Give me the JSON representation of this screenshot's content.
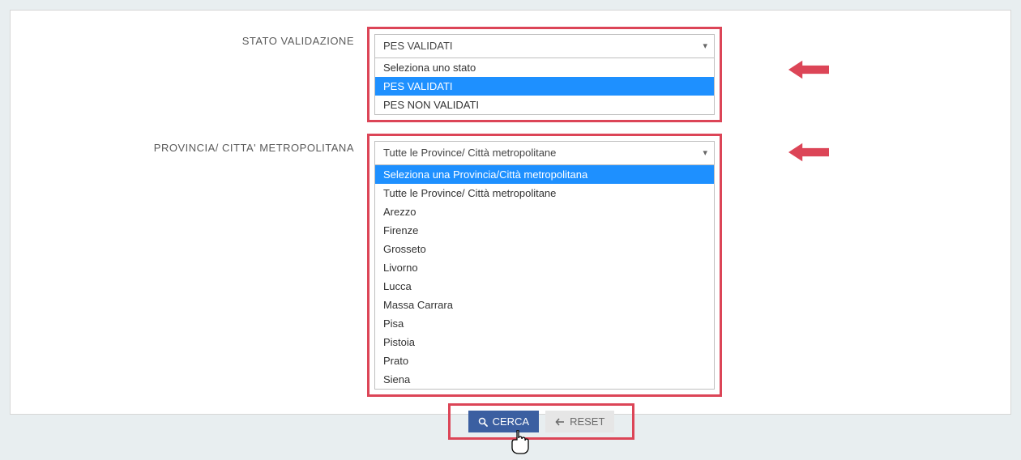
{
  "colors": {
    "highlight": "#dc4557",
    "selectBlue": "#1e90ff",
    "primaryBtn": "#3b5fa1"
  },
  "status": {
    "label": "STATO VALIDAZIONE",
    "selected": "PES VALIDATI",
    "options": [
      {
        "label": "Seleziona uno stato",
        "selected": false
      },
      {
        "label": "PES VALIDATI",
        "selected": true
      },
      {
        "label": "PES NON VALIDATI",
        "selected": false
      }
    ]
  },
  "province": {
    "label": "PROVINCIA/ CITTA' METROPOLITANA",
    "selected": "Tutte le Province/ Città metropolitane",
    "options": [
      {
        "label": "Seleziona una Provincia/Città metropolitana",
        "selected": true
      },
      {
        "label": "Tutte le Province/ Città metropolitane",
        "selected": false
      },
      {
        "label": "Arezzo",
        "selected": false
      },
      {
        "label": "Firenze",
        "selected": false
      },
      {
        "label": "Grosseto",
        "selected": false
      },
      {
        "label": "Livorno",
        "selected": false
      },
      {
        "label": "Lucca",
        "selected": false
      },
      {
        "label": "Massa Carrara",
        "selected": false
      },
      {
        "label": "Pisa",
        "selected": false
      },
      {
        "label": "Pistoia",
        "selected": false
      },
      {
        "label": "Prato",
        "selected": false
      },
      {
        "label": "Siena",
        "selected": false
      }
    ]
  },
  "buttons": {
    "search": "CERCA",
    "reset": "RESET"
  }
}
